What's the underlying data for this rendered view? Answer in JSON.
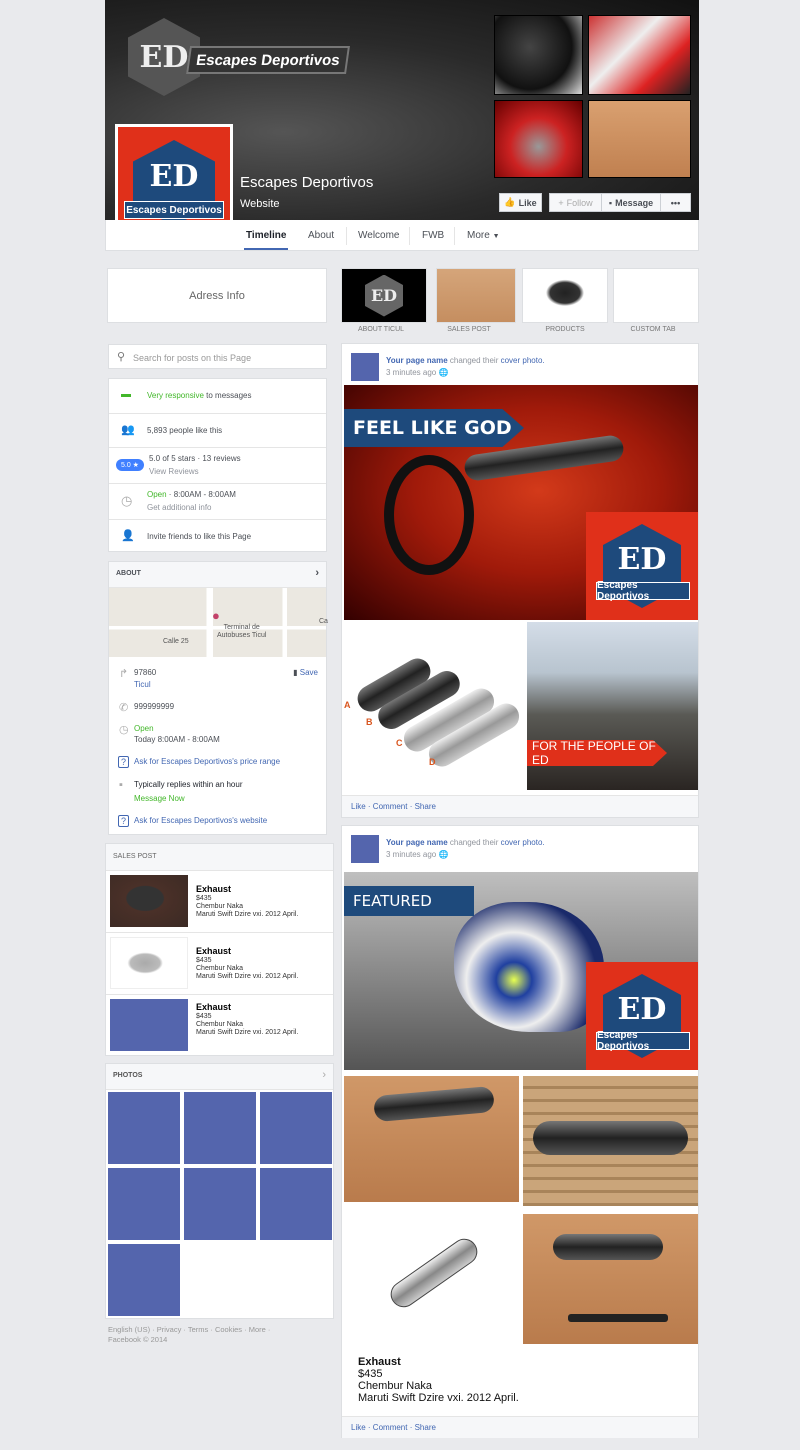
{
  "cover": {
    "logo_text": "Escapes Deportivos",
    "logo_initials": "ED",
    "page_name": "Escapes Deportivos",
    "category": "Website",
    "buttons": {
      "like": "Like",
      "follow": "Follow",
      "message": "Message",
      "more": "•••"
    }
  },
  "nav": {
    "tabs": [
      "Timeline",
      "About",
      "Welcome",
      "FWB",
      "More"
    ],
    "active": "Timeline"
  },
  "address_box": {
    "label": "Adress Info"
  },
  "app_tabs": [
    {
      "label": "ABOUT TICUL"
    },
    {
      "label": "SALES POST"
    },
    {
      "label": "PRODUCTS"
    },
    {
      "label": "CUSTOM TAB"
    }
  ],
  "search": {
    "placeholder": "Search for posts on this Page"
  },
  "info": {
    "responsive_hl": "Very responsive",
    "responsive_rest": " to messages",
    "likes": "5,893 people like this",
    "rating_badge": "5.0 ★",
    "rating": "5.0 of 5 stars · 13 reviews",
    "view_reviews": "View Reviews",
    "open": "Open",
    "hours": " · 8:00AM - 8:00AM",
    "additional": "Get additional info",
    "invite": "Invite friends to like this Page"
  },
  "about": {
    "title": "ABOUT",
    "map_label1": "Terminal de",
    "map_label2": "Autobuses Ticul",
    "map_street": "Calle 25",
    "map_edge": "Ca",
    "zip": "97860",
    "city": "Ticul",
    "save": "Save",
    "phone": "999999999",
    "open": "Open",
    "today": "Today 8:00AM - 8:00AM",
    "ask_price": "Ask for Escapes Deportivos's price range",
    "replies": "Typically replies within an hour",
    "message_now": "Message Now",
    "ask_website": "Ask for Escapes Deportivos's website"
  },
  "sales": {
    "title": "SALES POST",
    "items": [
      {
        "name": "Exhaust",
        "price": "$435",
        "loc": "Chembur Naka",
        "desc": "Maruti Swift Dzire vxi. 2012 April."
      },
      {
        "name": "Exhaust",
        "price": "$435",
        "loc": "Chembur Naka",
        "desc": "Maruti Swift Dzire vxi. 2012 April."
      },
      {
        "name": "Exhaust",
        "price": "$435",
        "loc": "Chembur Naka",
        "desc": "Maruti Swift Dzire vxi. 2012 April."
      }
    ]
  },
  "photos": {
    "title": "PHOTOS"
  },
  "footer": {
    "line1": "English (US) · Privacy · Terms · Cookies · More ·",
    "line2": "Facebook © 2014"
  },
  "posts": [
    {
      "author": "Your page name",
      "action": " changed their ",
      "object": "cover photo.",
      "time": "3 minutes ago",
      "banner": "FEEL LIKE GOD",
      "banner2": "FOR THE PEOPLE OF ED",
      "letters": [
        "A",
        "B",
        "C",
        "D"
      ],
      "like": "Like",
      "comment": "Comment",
      "share": "Share"
    },
    {
      "author": "Your page name",
      "action": " changed their ",
      "object": "cover photo.",
      "time": "3 minutes ago",
      "banner": "FEATURED",
      "product": {
        "name": "Exhaust",
        "price": "$435",
        "loc": "Chembur Naka",
        "desc": "Maruti Swift Dzire vxi. 2012 April."
      },
      "like": "Like",
      "comment": "Comment",
      "share": "Share"
    }
  ],
  "colors": {
    "bg": "#e9eaed",
    "brand_red": "#e0301a",
    "brand_blue": "#1e4a7c",
    "link": "#4267b2",
    "green": "#42b72a",
    "placeholder": "#5465ad"
  }
}
